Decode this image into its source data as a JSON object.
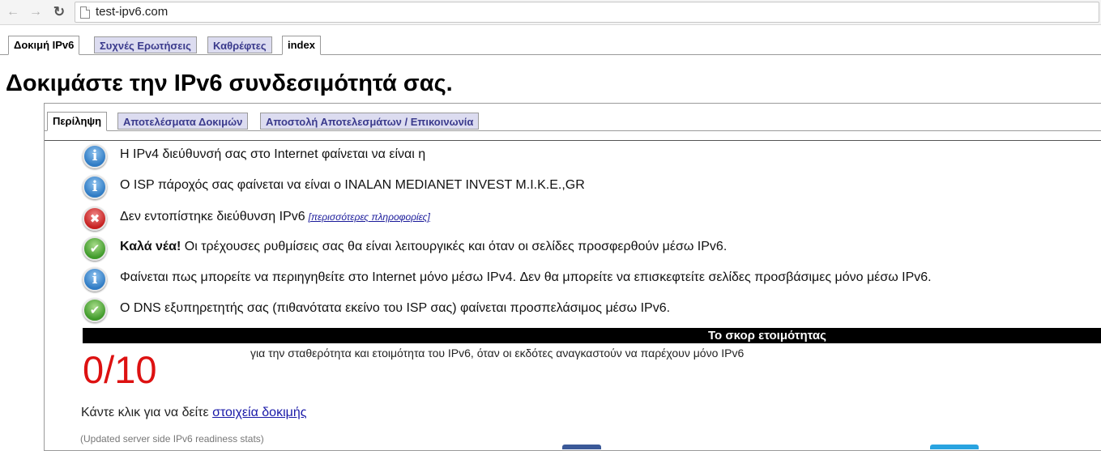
{
  "browser": {
    "url": "test-ipv6.com",
    "back_icon": "arrow-left-icon",
    "forward_icon": "arrow-right-icon",
    "reload_icon": "reload-icon"
  },
  "top_tabs": [
    "Δοκιμή IPv6",
    "Συχνές Ερωτήσεις",
    "Καθρέφτες",
    "index"
  ],
  "page_title": "Δοκιμάστε την IPv6 συνδεσιμότητά σας.",
  "inner_tabs": [
    "Περίληψη",
    "Αποτελέσματα Δοκιμών",
    "Αποστολή Αποτελεσμάτων / Επικοινωνία"
  ],
  "results": [
    {
      "icon": "info-icon",
      "text": "Η IPv4 διεύθυνσή σας στο Internet φαίνεται να είναι η"
    },
    {
      "icon": "info-icon",
      "text": "Ο ISP πάροχός σας φαίνεται να είναι ο INALAN MEDIANET INVEST M.I.K.E.,GR"
    },
    {
      "icon": "error-icon",
      "text": "Δεν εντοπίστηκε διεύθυνση IPv6",
      "more_link": "[περισσότερες πληροφορίες]"
    },
    {
      "icon": "ok-icon",
      "bold": "Καλά νέα!",
      "text": " Οι τρέχουσες ρυθμίσεις σας θα είναι λειτουργικές και όταν οι σελίδες προσφερθούν μέσω IPv6."
    },
    {
      "icon": "info-icon",
      "text": "Φαίνεται πως μπορείτε να περιηγηθείτε στο Internet μόνο μέσω IPv4. Δεν θα μπορείτε να επισκεφτείτε σελίδες προσβάσιμες μόνο μέσω IPv6."
    },
    {
      "icon": "ok-icon",
      "text": "Ο DNS εξυπηρετητής σας (πιθανότατα εκείνο του ISP σας) φαίνεται προσπελάσιμος μέσω IPv6."
    }
  ],
  "readiness": {
    "header": "Το σκορ ετοιμότητας",
    "score": "0/10",
    "description": "για την σταθερότητα και ετοιμότητα του IPv6, όταν οι εκδότες αναγκαστούν να παρέχουν μόνο IPv6"
  },
  "details": {
    "prefix": "Κάντε κλικ για να δείτε ",
    "link": "στοιχεία δοκιμής"
  },
  "stats_note": "(Updated server side IPv6 readiness stats)",
  "colors": {
    "score_red": "#dd1111",
    "tab_inactive_bg": "#dcdcf0",
    "tab_inactive_text": "#3a3a8c",
    "link": "#1a1aa8"
  }
}
